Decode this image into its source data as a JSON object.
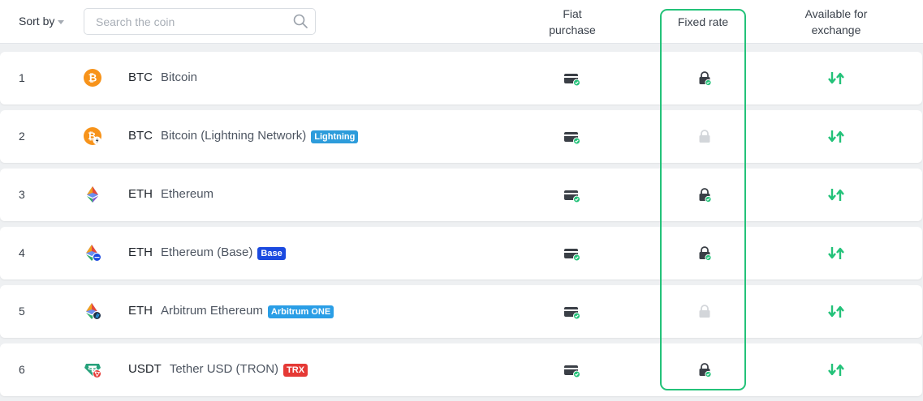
{
  "header": {
    "sort_label": "Sort by",
    "search_placeholder": "Search the coin",
    "col_fiat_line1": "Fiat",
    "col_fiat_line2": "purchase",
    "col_fixed": "Fixed rate",
    "col_avail_line1": "Available for",
    "col_avail_line2": "exchange"
  },
  "colors": {
    "accent_green": "#23c279",
    "btc_orange": "#f7931a",
    "lightning_badge": "#2d9cdb",
    "base_badge": "#1b4ae0",
    "arbitrum_badge": "#2a9ee6",
    "trx_badge": "#e53935"
  },
  "rows": [
    {
      "num": "1",
      "ticker": "BTC",
      "name": "Bitcoin",
      "badge": "",
      "icon": "bitcoin-icon",
      "fixed_rate": true
    },
    {
      "num": "2",
      "ticker": "BTC",
      "name": "Bitcoin (Lightning Network)",
      "badge": "Lightning",
      "icon": "bitcoin-lightning-icon",
      "fixed_rate": false
    },
    {
      "num": "3",
      "ticker": "ETH",
      "name": "Ethereum",
      "badge": "",
      "icon": "ethereum-icon",
      "fixed_rate": true
    },
    {
      "num": "4",
      "ticker": "ETH",
      "name": "Ethereum (Base)",
      "badge": "Base",
      "icon": "ethereum-base-icon",
      "fixed_rate": true
    },
    {
      "num": "5",
      "ticker": "ETH",
      "name": "Arbitrum Ethereum",
      "badge": "Arbitrum ONE",
      "icon": "ethereum-arbitrum-icon",
      "fixed_rate": false
    },
    {
      "num": "6",
      "ticker": "USDT",
      "name": "Tether USD (TRON)",
      "badge": "TRX",
      "icon": "tether-tron-icon",
      "fixed_rate": true
    }
  ]
}
